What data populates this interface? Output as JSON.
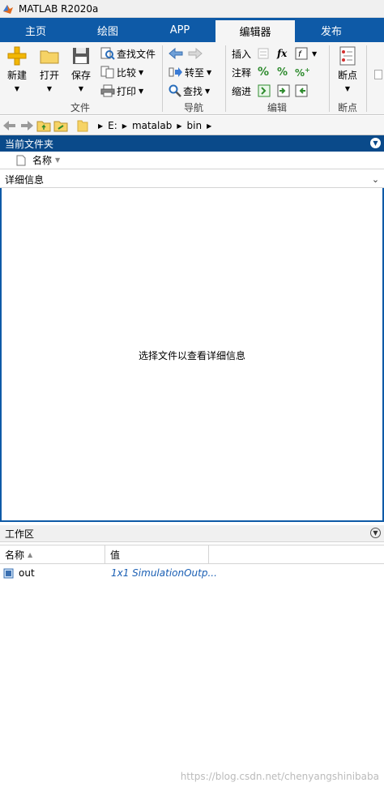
{
  "window": {
    "title": "MATLAB R2020a"
  },
  "tabs": [
    {
      "label": "主页"
    },
    {
      "label": "绘图"
    },
    {
      "label": "APP"
    },
    {
      "label": "编辑器"
    },
    {
      "label": "发布"
    }
  ],
  "ribbon": {
    "file": {
      "new": "新建",
      "open": "打开",
      "save": "保存",
      "find_files": "查找文件",
      "compare": "比较",
      "print": "打印",
      "group_label": "文件"
    },
    "navigate": {
      "goto": "转至",
      "find": "查找",
      "group_label": "导航"
    },
    "edit": {
      "insert": "插入",
      "comment": "注释",
      "indent": "缩进",
      "fx": "fx",
      "group_label": "编辑"
    },
    "breakpoints": {
      "breakpoints": "断点",
      "group_label": "断点"
    }
  },
  "address": {
    "segments": [
      "E:",
      "matalab",
      "bin"
    ]
  },
  "current_folder": {
    "title": "当前文件夹",
    "col_name": "名称"
  },
  "details": {
    "title": "详细信息",
    "message": "选择文件以查看详细信息"
  },
  "workspace": {
    "title": "工作区",
    "col_name": "名称",
    "col_value": "值",
    "rows": [
      {
        "name": "out",
        "value": "1x1 SimulationOutp..."
      }
    ]
  },
  "watermark": "https://blog.csdn.net/chenyangshinibaba",
  "colors": {
    "tab_bar": "#0e5aa7",
    "panel_header": "#0a4a8a",
    "ribbon_bg": "#f5f5f5",
    "value_text": "#1a5fb4"
  }
}
